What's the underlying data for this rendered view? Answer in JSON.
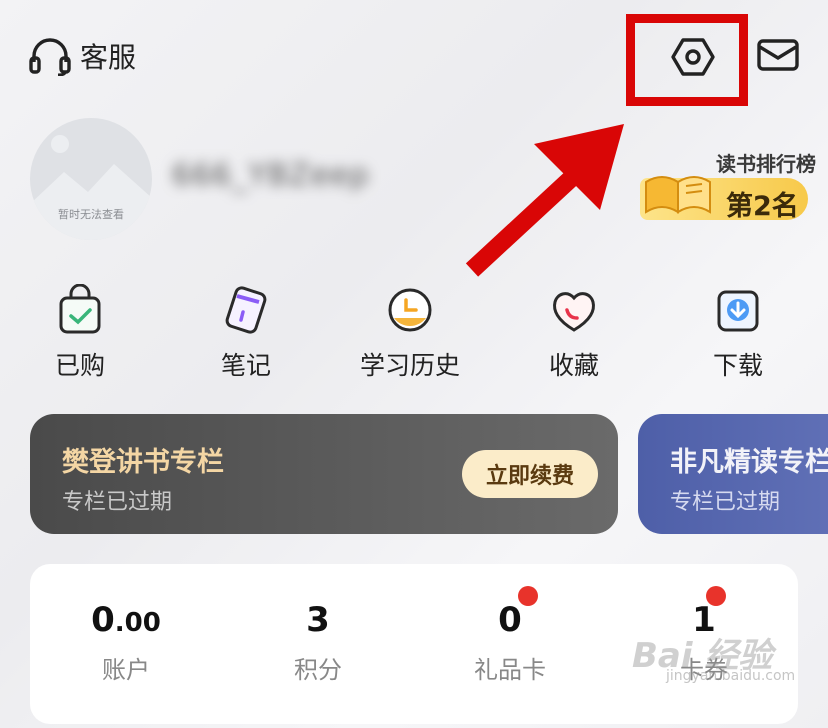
{
  "header": {
    "service_label": "客服",
    "settings_icon": "settings-icon",
    "mail_icon": "mail-icon"
  },
  "profile": {
    "avatar_caption": "暂时无法查看",
    "username": "666_YBZeep"
  },
  "rank": {
    "title": "读书排行榜",
    "value": "第2名"
  },
  "quick_menu": [
    {
      "label": "已购",
      "icon": "shopping-bag-icon"
    },
    {
      "label": "笔记",
      "icon": "note-icon"
    },
    {
      "label": "学习历史",
      "icon": "clock-icon"
    },
    {
      "label": "收藏",
      "icon": "heart-icon"
    },
    {
      "label": "下载",
      "icon": "download-icon"
    }
  ],
  "cards": [
    {
      "title": "樊登讲书专栏",
      "subtitle": "专栏已过期",
      "button": "立即续费"
    },
    {
      "title": "非凡精读专栏",
      "subtitle": "专栏已过期"
    }
  ],
  "stats": [
    {
      "value_main": "0",
      "value_decimal": ".00",
      "label": "账户"
    },
    {
      "value_main": "3",
      "label": "积分"
    },
    {
      "value_main": "0",
      "label": "礼品卡"
    },
    {
      "value_main": "1",
      "label": "卡券"
    }
  ],
  "watermark": {
    "text": "Bai 经验",
    "url": "jingyan.baidu.com"
  },
  "colors": {
    "annotation_red": "#d90606",
    "badge_dot": "#e8332b",
    "card_dark": "#4a4a4a",
    "card_blue": "#4e5fa8"
  }
}
